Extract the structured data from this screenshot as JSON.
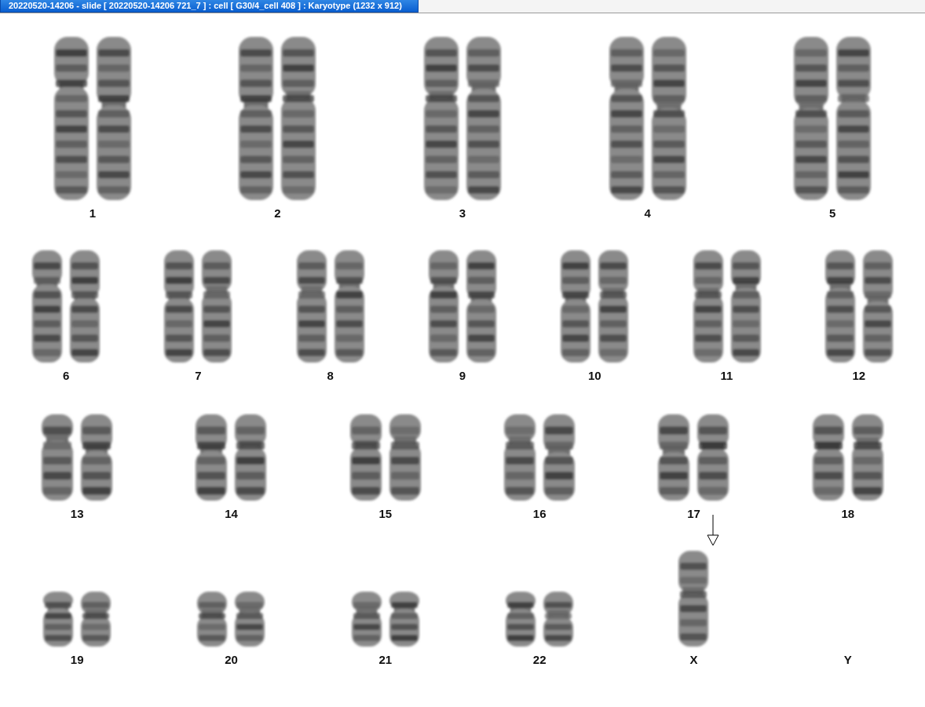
{
  "window": {
    "title": "20220520-14206 - slide [ 20220520-14206 721_7 ] : cell [ G30/4_cell 408 ] : Karyotype  (1232 x 912)"
  },
  "karyotype": {
    "rows": [
      {
        "groups": [
          {
            "label": "1",
            "kind": "pair"
          },
          {
            "label": "2",
            "kind": "pair"
          },
          {
            "label": "3",
            "kind": "pair"
          },
          {
            "label": "4",
            "kind": "pair"
          },
          {
            "label": "5",
            "kind": "pair"
          }
        ]
      },
      {
        "groups": [
          {
            "label": "6",
            "kind": "pair"
          },
          {
            "label": "7",
            "kind": "pair"
          },
          {
            "label": "8",
            "kind": "pair"
          },
          {
            "label": "9",
            "kind": "pair"
          },
          {
            "label": "10",
            "kind": "pair"
          },
          {
            "label": "11",
            "kind": "pair"
          },
          {
            "label": "12",
            "kind": "pair"
          }
        ]
      },
      {
        "groups": [
          {
            "label": "13",
            "kind": "pair"
          },
          {
            "label": "14",
            "kind": "pair"
          },
          {
            "label": "15",
            "kind": "pair"
          },
          {
            "label": "16",
            "kind": "pair"
          },
          {
            "label": "17",
            "kind": "pair"
          },
          {
            "label": "18",
            "kind": "pair"
          }
        ]
      },
      {
        "groups": [
          {
            "label": "19",
            "kind": "pair"
          },
          {
            "label": "20",
            "kind": "pair"
          },
          {
            "label": "21",
            "kind": "pair"
          },
          {
            "label": "22",
            "kind": "pair"
          },
          {
            "label": "X",
            "kind": "single",
            "marked": true
          },
          {
            "label": "Y",
            "kind": "empty"
          }
        ]
      }
    ]
  }
}
